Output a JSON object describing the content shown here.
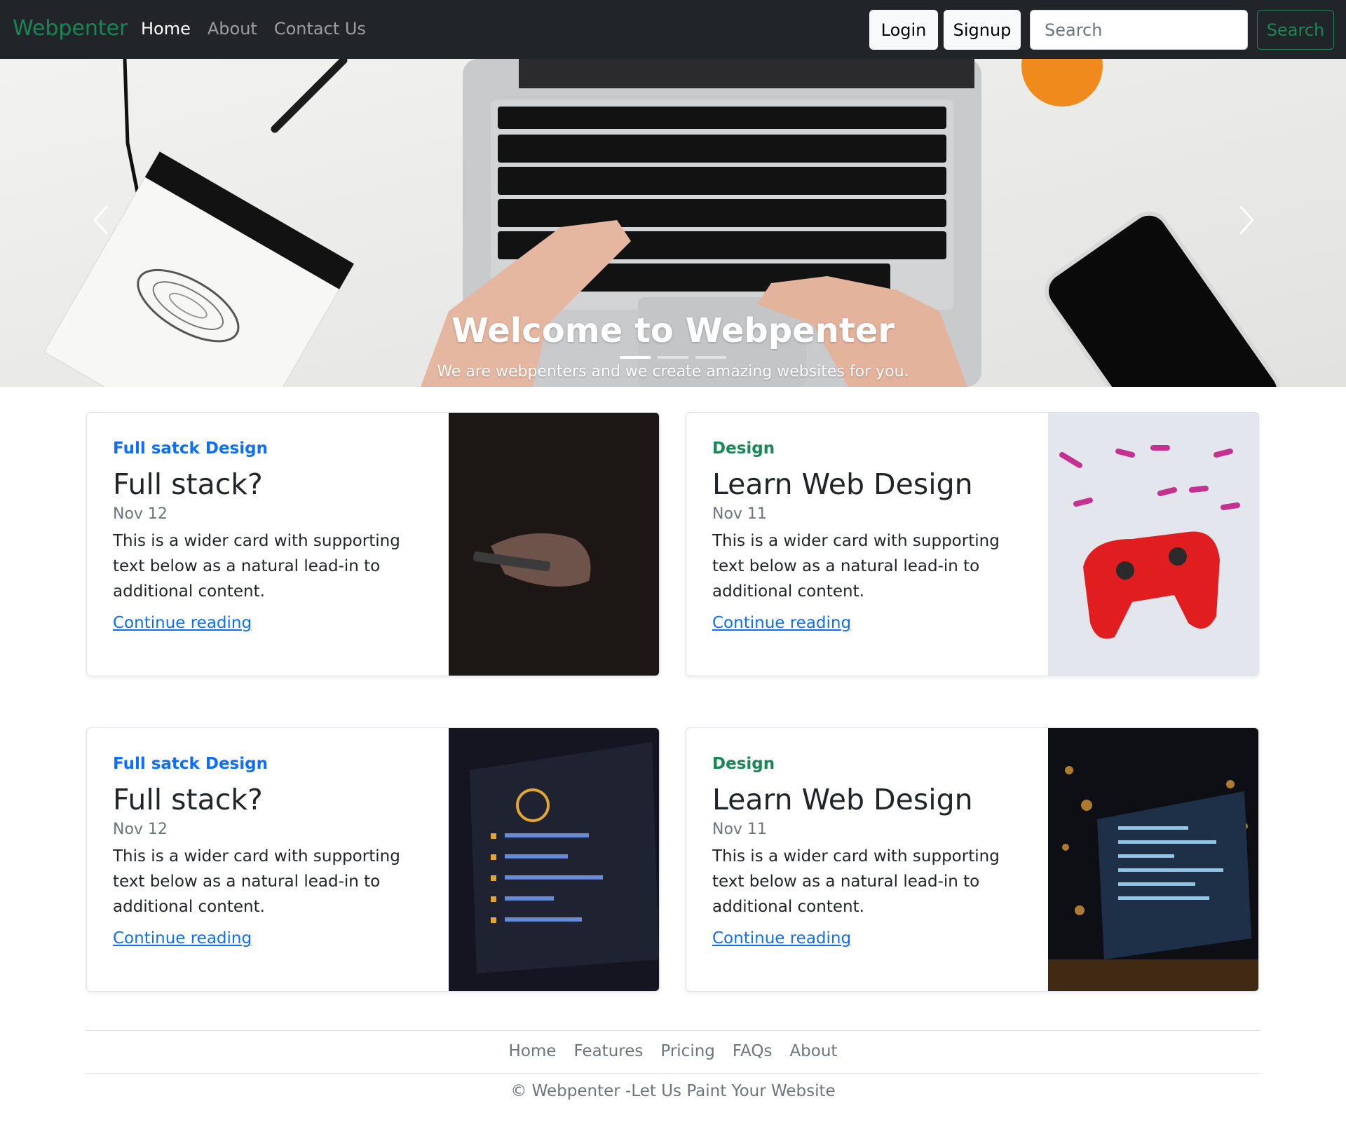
{
  "navbar": {
    "brand": "Webpenter",
    "links": [
      {
        "label": "Home",
        "active": true
      },
      {
        "label": "About",
        "active": false
      },
      {
        "label": "Contact Us",
        "active": false
      }
    ],
    "login_label": "Login",
    "signup_label": "Signup",
    "search_placeholder": "Search",
    "search_button": "Search"
  },
  "carousel": {
    "title": "Welcome to Webpenter",
    "subtitle": "We are webpenters and we create amazing websites for you.",
    "slide_count": 3,
    "active_slide": 1
  },
  "cards": [
    {
      "category": "Full satck Design",
      "title": "Full stack?",
      "date": "Nov 12",
      "text": "This is a wider card with supporting text below as a natural lead-in to additional content.",
      "link": "Continue reading"
    },
    {
      "category": "Design",
      "title": "Learn Web Design",
      "date": "Nov 11",
      "text": "This is a wider card with supporting text below as a natural lead-in to additional content.",
      "link": "Continue reading"
    },
    {
      "category": "Full satck Design",
      "title": "Full stack?",
      "date": "Nov 12",
      "text": "This is a wider card with supporting text below as a natural lead-in to additional content.",
      "link": "Continue reading"
    },
    {
      "category": "Design",
      "title": "Learn Web Design",
      "date": "Nov 11",
      "text": "This is a wider card with supporting text below as a natural lead-in to additional content.",
      "link": "Continue reading"
    }
  ],
  "footer": {
    "links": [
      "Home",
      "Features",
      "Pricing",
      "FAQs",
      "About"
    ],
    "copyright": "© Webpenter -Let Us Paint Your Website"
  },
  "colors": {
    "navbar_bg": "#212529",
    "brand": "#198754",
    "link": "#0d6efd",
    "muted": "#6c757d"
  },
  "icons": [
    "chevron-left-icon",
    "chevron-right-icon"
  ]
}
